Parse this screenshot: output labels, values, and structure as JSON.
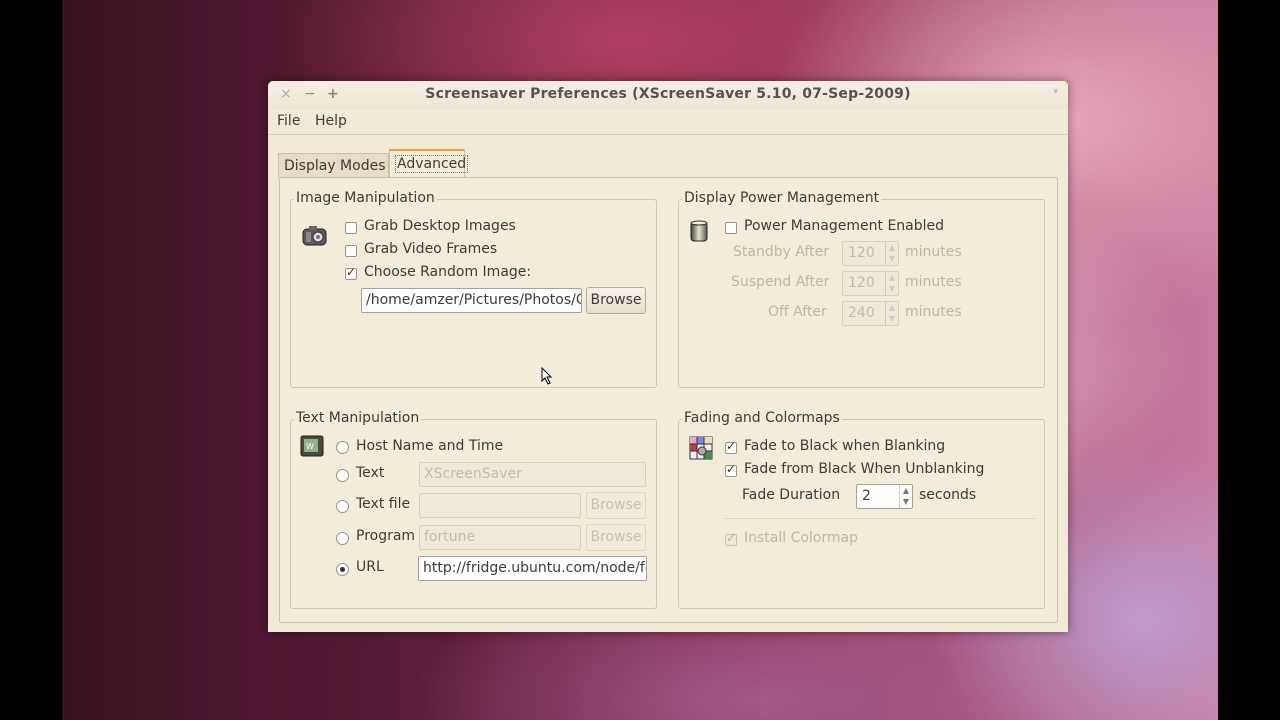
{
  "window": {
    "title": "Screensaver Preferences  (XScreenSaver 5.10, 07-Sep-2009)",
    "controls": {
      "close": "×",
      "minimize": "−",
      "maximize": "+",
      "menu": "▾"
    }
  },
  "menubar": {
    "file": "File",
    "help": "Help"
  },
  "tabs": [
    {
      "label": "Display Modes",
      "active": false
    },
    {
      "label": "Advanced",
      "active": true
    }
  ],
  "image_manipulation": {
    "title": "Image Manipulation",
    "icon": "camera-icon",
    "grab_desktop": {
      "label": "Grab Desktop Images",
      "checked": false
    },
    "grab_video": {
      "label": "Grab Video Frames",
      "checked": false
    },
    "random_image": {
      "label": "Choose Random Image:",
      "checked": true
    },
    "path_value": "/home/amzer/Pictures/Photos/Ol",
    "browse_label": "Browse"
  },
  "display_power": {
    "title": "Display Power Management",
    "icon": "power-battery-icon",
    "enabled": {
      "label": "Power Management Enabled",
      "checked": false
    },
    "standby": {
      "label": "Standby After",
      "value": "120",
      "unit": "minutes"
    },
    "suspend": {
      "label": "Suspend After",
      "value": "120",
      "unit": "minutes"
    },
    "off": {
      "label": "Off After",
      "value": "240",
      "unit": "minutes"
    }
  },
  "text_manipulation": {
    "title": "Text Manipulation",
    "icon": "text-display-icon",
    "options": [
      {
        "label": "Host Name and Time",
        "selected": false
      },
      {
        "label": "Text",
        "selected": false,
        "value": "XScreenSaver"
      },
      {
        "label": "Text file",
        "selected": false,
        "value": "",
        "browse": "Browse"
      },
      {
        "label": "Program",
        "selected": false,
        "value": "fortune",
        "browse": "Browse"
      },
      {
        "label": "URL",
        "selected": true,
        "value": "http://fridge.ubuntu.com/node/fee"
      }
    ]
  },
  "fading": {
    "title": "Fading and Colormaps",
    "icon": "colormap-icon",
    "fade_to_black": {
      "label": "Fade to Black when Blanking",
      "checked": true
    },
    "fade_from_black": {
      "label": "Fade from Black When Unblanking",
      "checked": true
    },
    "fade_duration": {
      "label": "Fade Duration",
      "value": "2",
      "unit": "seconds"
    },
    "install_colormap": {
      "label": "Install Colormap",
      "checked": true,
      "disabled": true
    }
  }
}
